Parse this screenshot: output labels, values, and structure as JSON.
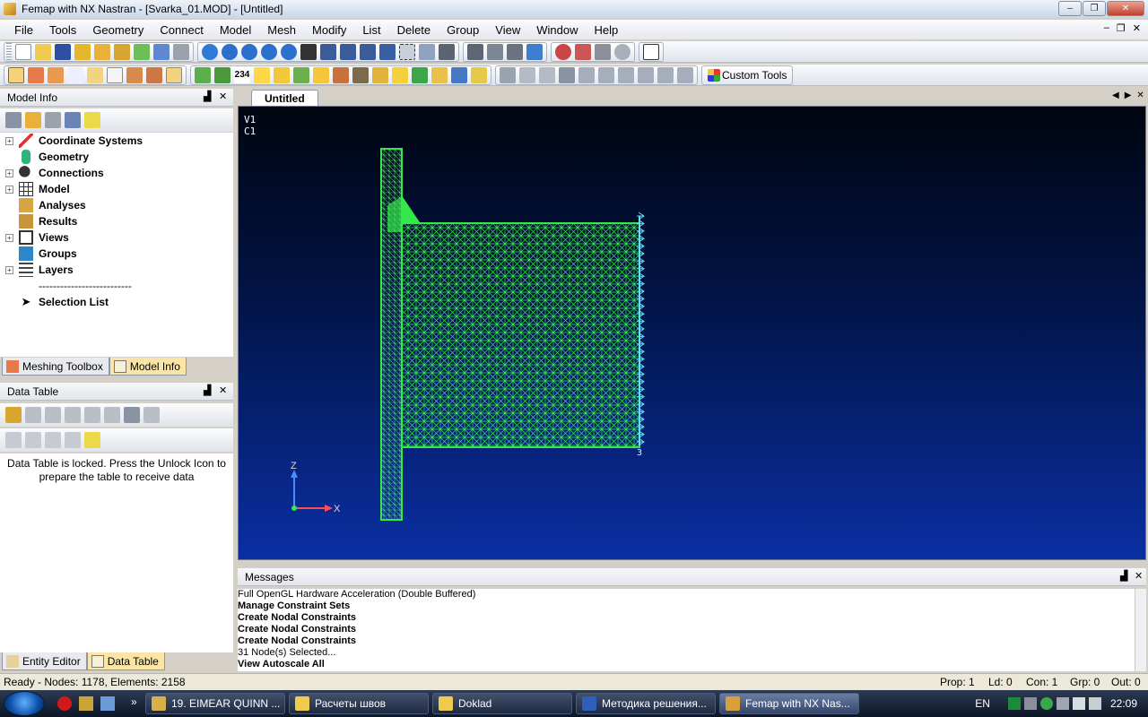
{
  "window": {
    "title": "Femap with NX Nastran - [Svarka_01.MOD] - [Untitled]"
  },
  "menu": [
    "File",
    "Tools",
    "Geometry",
    "Connect",
    "Model",
    "Mesh",
    "Modify",
    "List",
    "Delete",
    "Group",
    "View",
    "Window",
    "Help"
  ],
  "toolbar": {
    "custom_tools_label": "Custom Tools",
    "node_id_badge": "234"
  },
  "model_info": {
    "title": "Model Info",
    "tree": [
      {
        "label": "Coordinate Systems",
        "icon": "axes-icon",
        "expandable": true
      },
      {
        "label": "Geometry",
        "icon": "cylinder-icon",
        "expandable": false
      },
      {
        "label": "Connections",
        "icon": "magnifier-icon",
        "expandable": true
      },
      {
        "label": "Model",
        "icon": "grid-icon",
        "expandable": true
      },
      {
        "label": "Analyses",
        "icon": "analysis-icon",
        "expandable": false
      },
      {
        "label": "Results",
        "icon": "results-icon",
        "expandable": false
      },
      {
        "label": "Views",
        "icon": "view-icon",
        "expandable": true
      },
      {
        "label": "Groups",
        "icon": "groups-icon",
        "expandable": false
      },
      {
        "label": "Layers",
        "icon": "layers-icon",
        "expandable": true
      },
      {
        "label": "--------------------------",
        "icon": "",
        "expandable": false
      },
      {
        "label": "Selection List",
        "icon": "cursor-icon",
        "expandable": false
      }
    ],
    "tabs": [
      {
        "label": "Meshing Toolbox",
        "active": false
      },
      {
        "label": "Model Info",
        "active": true
      }
    ]
  },
  "data_table": {
    "title": "Data Table",
    "locked_message": "Data Table is locked. Press the Unlock Icon to prepare the table to receive data",
    "tabs": [
      {
        "label": "Entity Editor",
        "active": false
      },
      {
        "label": "Data Table",
        "active": true
      }
    ]
  },
  "graphics": {
    "tab_label": "Untitled",
    "view_label": "V1",
    "csys_label": "C1",
    "constraint_label": "3",
    "axis_z": "Z",
    "axis_x": "X",
    "colors": {
      "mesh": "#35e84a",
      "constraint": "#5fe0f0",
      "bg_top": "#000510",
      "bg_bottom": "#0a2fa3"
    }
  },
  "messages": {
    "title": "Messages",
    "lines": [
      {
        "text": "Full OpenGL Hardware Acceleration (Double Buffered)",
        "bold": false
      },
      {
        "text": "Manage Constraint Sets",
        "bold": true
      },
      {
        "text": "Create Nodal Constraints",
        "bold": true
      },
      {
        "text": "Create Nodal Constraints",
        "bold": true
      },
      {
        "text": "Create Nodal Constraints",
        "bold": true
      },
      {
        "text": "31 Node(s) Selected...",
        "bold": false
      },
      {
        "text": "View Autoscale All",
        "bold": true
      }
    ]
  },
  "status": {
    "left": "Ready - Nodes: 1178,  Elements: 2158",
    "prop": "Prop: 1",
    "ld": "Ld: 0",
    "con": "Con: 1",
    "grp": "Grp: 0",
    "out": "Out: 0"
  },
  "taskbar": {
    "tasks": [
      {
        "label": "19. EIMEAR QUINN ...",
        "active": false
      },
      {
        "label": "Расчеты швов",
        "active": false
      },
      {
        "label": "Doklad",
        "active": false
      },
      {
        "label": "Методика решения...",
        "active": false
      },
      {
        "label": "Femap with NX Nas...",
        "active": true
      }
    ],
    "lang": "EN",
    "time": "22:09"
  }
}
